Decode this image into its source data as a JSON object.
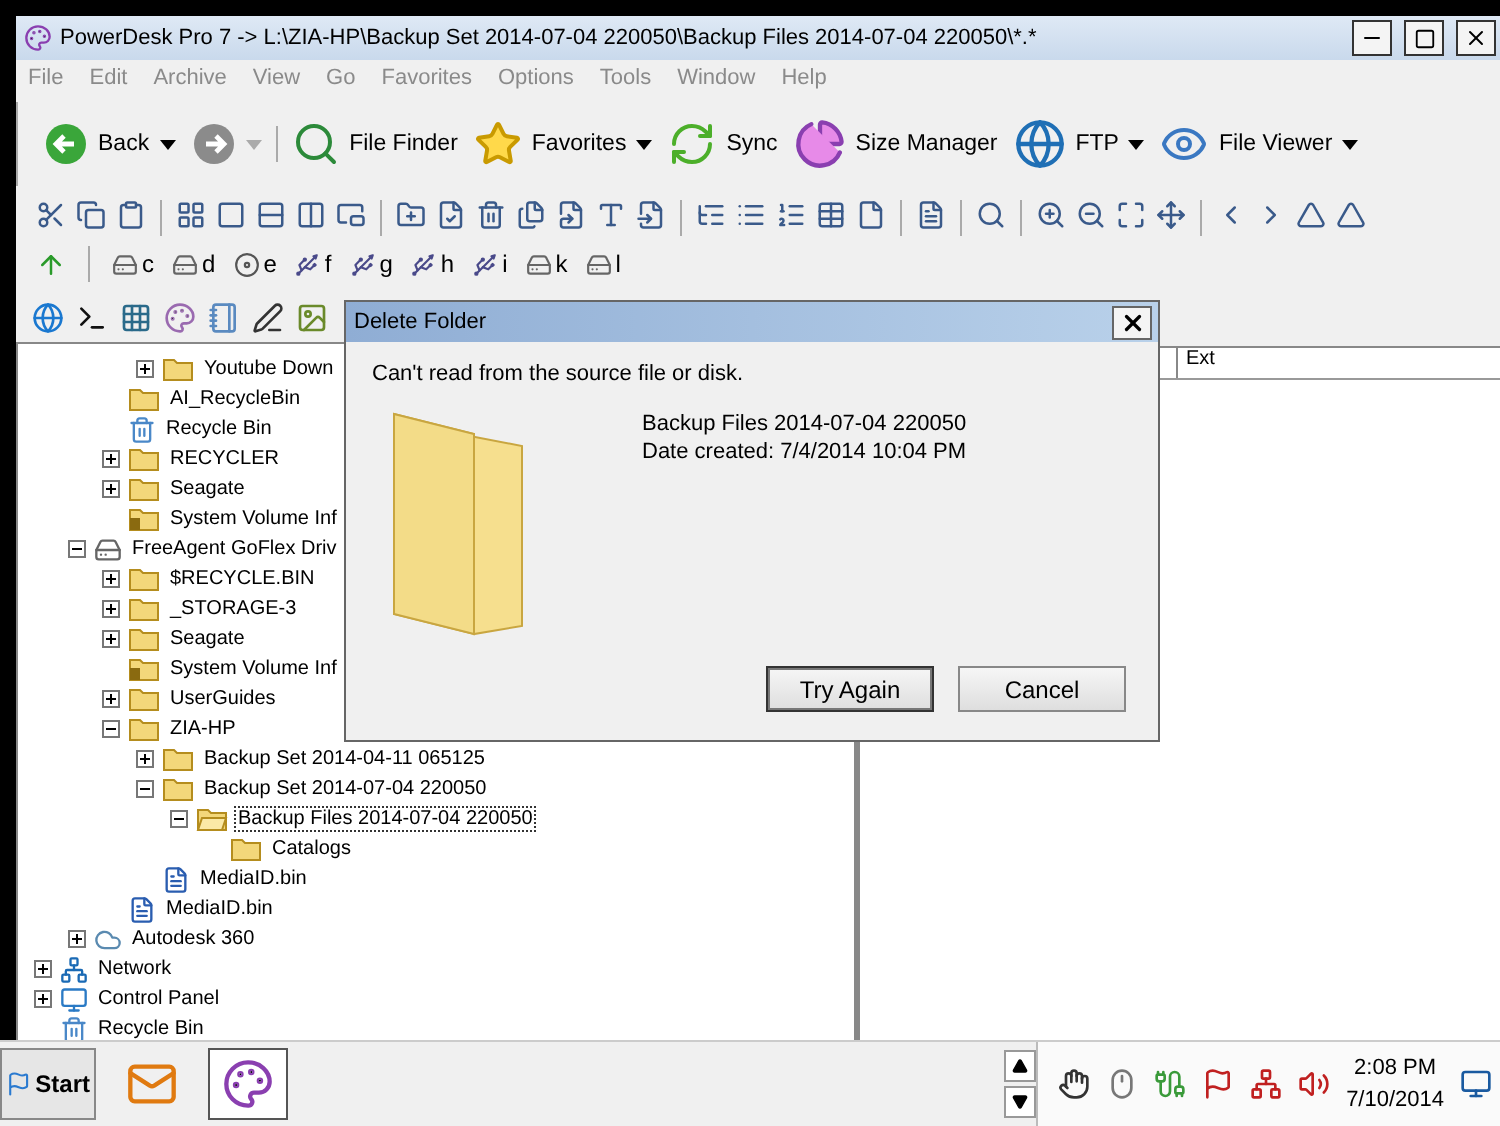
{
  "window": {
    "title": "PowerDesk Pro 7 -> L:\\ZIA-HP\\Backup Set 2014-07-04 220050\\Backup Files 2014-07-04 220050\\*.*"
  },
  "menu": [
    "File",
    "Edit",
    "Archive",
    "View",
    "Go",
    "Favorites",
    "Options",
    "Tools",
    "Window",
    "Help"
  ],
  "main_toolbar": [
    {
      "kind": "back",
      "label": "Back",
      "dropdown": true,
      "disabled": false
    },
    {
      "kind": "forward",
      "dropdown": true,
      "disabled": true
    },
    {
      "kind": "finder",
      "label": "File Finder",
      "dropdown": false,
      "disabled": false
    },
    {
      "kind": "favorites",
      "label": "Favorites",
      "dropdown": true,
      "disabled": false
    },
    {
      "kind": "sync",
      "label": "Sync",
      "dropdown": false,
      "disabled": false
    },
    {
      "kind": "size",
      "label": "Size Manager",
      "dropdown": false,
      "disabled": false
    },
    {
      "kind": "ftp",
      "label": "FTP",
      "dropdown": true,
      "disabled": false
    },
    {
      "kind": "viewer",
      "label": "File Viewer",
      "dropdown": true,
      "disabled": false
    }
  ],
  "drives": [
    {
      "letter": "c",
      "kind": "disk"
    },
    {
      "letter": "d",
      "kind": "disk"
    },
    {
      "letter": "e",
      "kind": "optical"
    },
    {
      "letter": "f",
      "kind": "removable"
    },
    {
      "letter": "g",
      "kind": "removable"
    },
    {
      "letter": "h",
      "kind": "removable"
    },
    {
      "letter": "i",
      "kind": "removable"
    },
    {
      "letter": "k",
      "kind": "disk"
    },
    {
      "letter": "l",
      "kind": "disk"
    }
  ],
  "tree": [
    {
      "children": [
        {
          "children": [
            {
              "children": [
                {
                  "label": "Youtube Down",
                  "kind": "folder",
                  "expanded": false,
                  "selected": false
                }
              ]
            },
            {
              "label": "AI_RecycleBin",
              "kind": "folder",
              "selected": false
            },
            {
              "label": "Recycle Bin",
              "kind": "recycle",
              "selected": false
            },
            {
              "label": "RECYCLER",
              "kind": "folder",
              "expanded": false,
              "selected": false
            },
            {
              "label": "Seagate",
              "kind": "folder",
              "expanded": false,
              "selected": false
            },
            {
              "label": "System Volume Inf",
              "kind": "locked-folder",
              "selected": false
            }
          ]
        },
        {
          "label": "FreeAgent GoFlex Driv",
          "kind": "drive",
          "expanded": true,
          "selected": false,
          "children": [
            {
              "label": "$RECYCLE.BIN",
              "kind": "folder",
              "expanded": false,
              "selected": false
            },
            {
              "label": "_STORAGE-3",
              "kind": "folder",
              "expanded": false,
              "selected": false
            },
            {
              "label": "Seagate",
              "kind": "folder",
              "expanded": false,
              "selected": false
            },
            {
              "label": "System Volume Inf",
              "kind": "locked-folder",
              "selected": false
            },
            {
              "label": "UserGuides",
              "kind": "folder",
              "expanded": false,
              "selected": false
            },
            {
              "label": "ZIA-HP",
              "kind": "folder",
              "expanded": true,
              "selected": false,
              "children": [
                {
                  "label": "Backup Set 2014-04-11 065125",
                  "kind": "folder",
                  "expanded": false,
                  "selected": false
                },
                {
                  "label": "Backup Set 2014-07-04 220050",
                  "kind": "folder",
                  "expanded": true,
                  "selected": false,
                  "children": [
                    {
                      "label": "Backup Files 2014-07-04 220050",
                      "kind": "open-folder",
                      "expanded": true,
                      "selected": true,
                      "children": [
                        {
                          "label": "Catalogs",
                          "kind": "folder",
                          "selected": false
                        }
                      ]
                    }
                  ]
                },
                {
                  "label": "MediaID.bin",
                  "kind": "file",
                  "selected": false
                }
              ]
            },
            {
              "label": "MediaID.bin",
              "kind": "file",
              "selected": false
            }
          ]
        },
        {
          "label": "Autodesk 360",
          "kind": "cloud",
          "expanded": false,
          "selected": false
        }
      ]
    },
    {
      "label": "Network",
      "kind": "network",
      "expanded": false,
      "selected": false
    },
    {
      "label": "Control Panel",
      "kind": "control-panel",
      "expanded": false,
      "selected": false
    },
    {
      "label": "Recycle Bin",
      "kind": "recycle",
      "selected": false
    }
  ],
  "file_list": {
    "columns": [
      "Ext"
    ]
  },
  "dialog": {
    "title": "Delete Folder",
    "message": "Can't read from the source file or disk.",
    "item_name": "Backup Files 2014-07-04 220050",
    "item_date": "Date created: 7/4/2014 10:04 PM",
    "buttons": [
      {
        "label": "Try Again",
        "default": true
      },
      {
        "label": "Cancel",
        "default": false
      }
    ]
  },
  "taskbar": {
    "start": "Start",
    "apps": [
      {
        "kind": "mail",
        "selected": false
      },
      {
        "kind": "powerdesk",
        "selected": true
      }
    ],
    "time": "2:08 PM",
    "date": "7/10/2014"
  }
}
